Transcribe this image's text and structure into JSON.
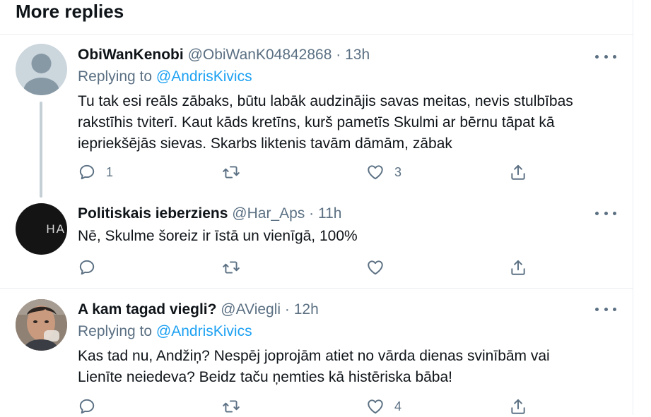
{
  "header": {
    "title": "More replies"
  },
  "tweets": [
    {
      "name": "ObiWanKenobi",
      "handle": "@ObiWanK04842868",
      "dot": "·",
      "time": "13h",
      "replying_prefix": "Replying to ",
      "replying_to": "@AndrisKivics",
      "lines": [
        "Tu tak esi reāls zābaks, būtu labāk audzinājis savas meitas, nevis stulbības",
        "rakstīhis tviterī. Kaut kāds kretīns, kurš pametīs Skulmi ar bērnu tāpat kā",
        "iepriekšējās sievas. Skarbs liktenis tavām dāmām, zābak"
      ],
      "reply_count": "1",
      "retweet_count": "",
      "like_count": "3"
    },
    {
      "name": "Politiskais ieberziens",
      "handle": "@Har_Aps",
      "dot": "·",
      "time": "11h",
      "avatar_text": "HA",
      "lines": [
        "Nē, Skulme šoreiz ir īstā un vienīgā, 100%"
      ],
      "reply_count": "",
      "retweet_count": "",
      "like_count": ""
    },
    {
      "name": "A kam tagad viegli?",
      "handle": "@AViegli",
      "dot": "·",
      "time": "12h",
      "replying_prefix": "Replying to ",
      "replying_to": "@AndrisKivics",
      "lines": [
        "Kas tad nu, Andžiņ? Nespēj joprojām atiet no vārda dienas svinībām vai",
        "Lienīte neiedeva? Beidz taču ņemties kā histēriska bāba!"
      ],
      "reply_count": "",
      "retweet_count": "",
      "like_count": "4"
    }
  ],
  "icons": {
    "reply": "reply-icon",
    "retweet": "retweet-icon",
    "like": "heart-icon",
    "share": "share-icon",
    "more": "more-icon"
  },
  "colors": {
    "accent": "#1da1f2",
    "secondary_text": "#5b7083",
    "primary_text": "#0f1419",
    "divider": "#ebeef0"
  }
}
